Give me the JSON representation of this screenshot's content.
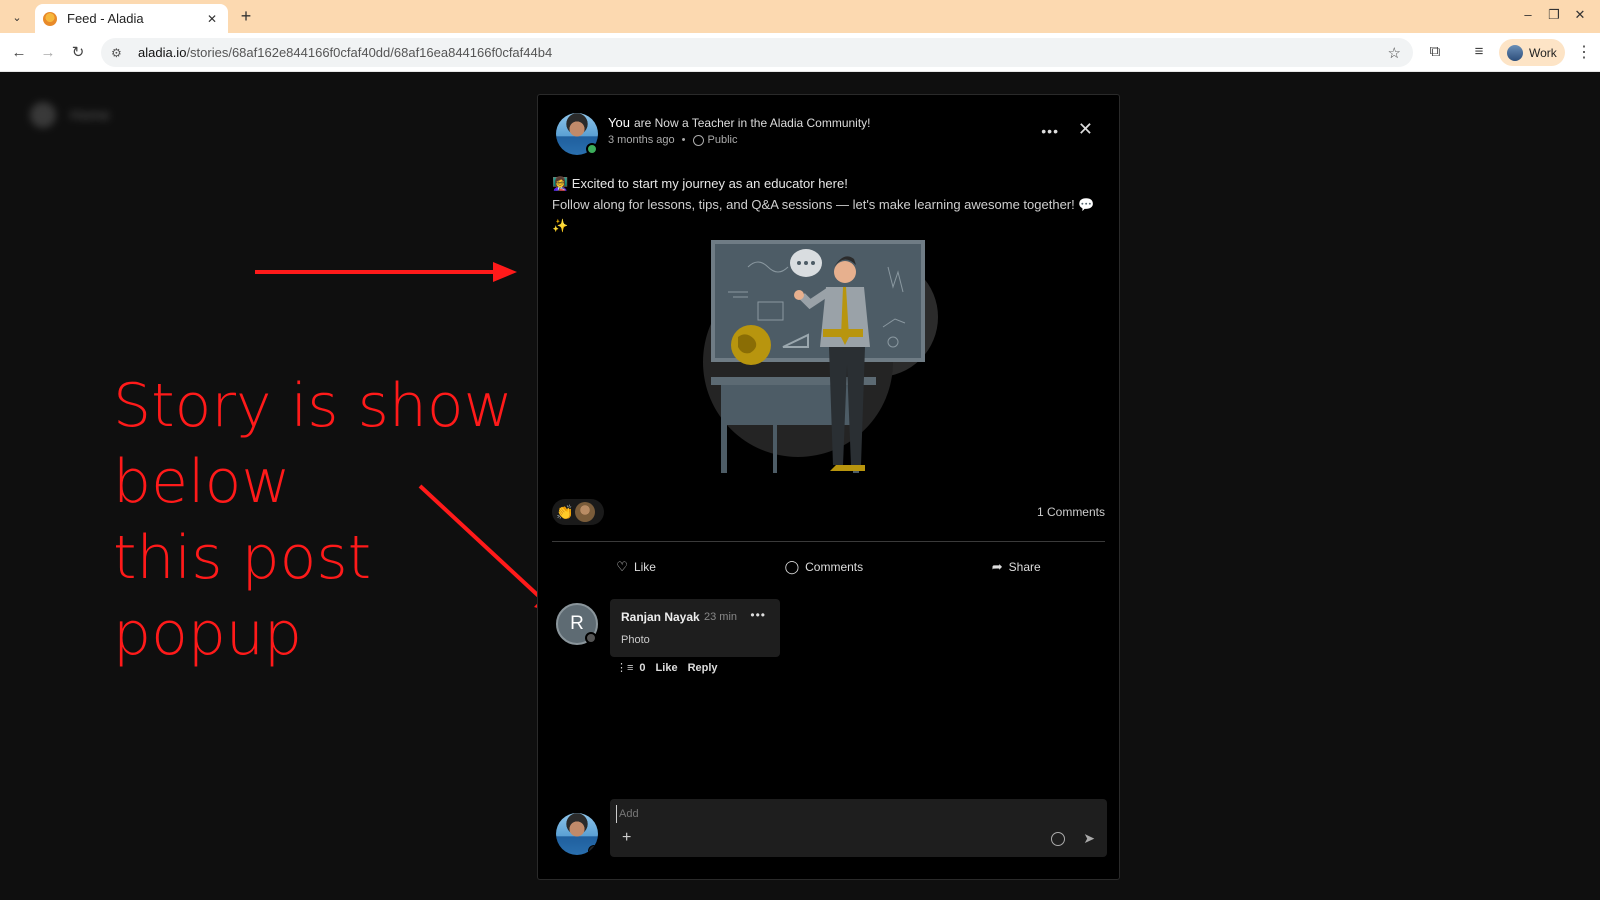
{
  "browser": {
    "tab_title": "Feed - Aladia",
    "tab_close": "✕",
    "new_tab": "+",
    "url_host": "aladia.io",
    "url_path": "/stories/68af162e844166f0cfaf40dd/68af16ea844166f0cfaf44b4",
    "profile_label": "Work"
  },
  "background": {
    "nav_label": "Home"
  },
  "annotation": {
    "lines": [
      "Story is show",
      "below",
      "this post",
      "popup"
    ],
    "color": "#ff1a1a"
  },
  "post": {
    "author": "You",
    "headline": "are Now a Teacher in the Aladia Community!",
    "time": "3 months ago",
    "bullet": "•",
    "visibility": "Public",
    "line1": "👩‍🏫 Excited to start my journey as an educator here!",
    "line2": "Follow along for lessons, tips, and Q&A sessions — let's make learning awesome together! 💬✨",
    "reaction_emoji": "👏",
    "comments_count": "1 Comments",
    "actions": {
      "like": "Like",
      "comments": "Comments",
      "share": "Share"
    }
  },
  "comment": {
    "avatar_letter": "R",
    "author": "Ranjan Nayak",
    "time": "23 min",
    "text": "Photo",
    "thread_count": "0",
    "like": "Like",
    "reply": "Reply"
  },
  "composer": {
    "placeholder": "Add"
  }
}
